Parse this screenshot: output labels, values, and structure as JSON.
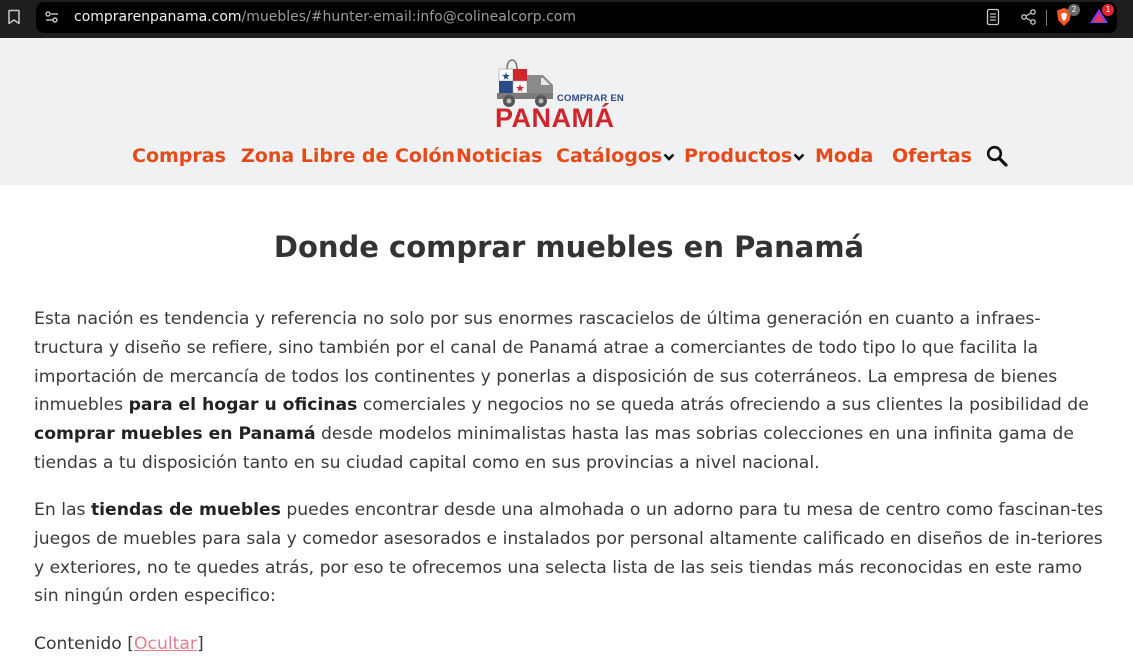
{
  "browser": {
    "url_host": "comprarenpanama.com",
    "url_path": "/muebles/#hunter-email:info@colinealcorp.com",
    "brave_shields_count": "2",
    "rewards_count": "1"
  },
  "site": {
    "logo_small": "COMPRAR EN",
    "logo_main": "PANAMÁ",
    "nav": [
      "Compras",
      "Zona Libre de Colón",
      "Noticias",
      "Catálogos",
      "Productos",
      "Moda",
      "Ofertas"
    ]
  },
  "article": {
    "title": "Donde comprar muebles en Panamá",
    "p1": {
      "t1": "Esta nación es tendencia y referencia no solo por sus enormes rascacielos de última generación en cuanto a infraes-tructura y diseño se refiere, sino también por el canal de Panamá atrae a comerciantes de todo tipo lo que facilita la importación de mercancía de todos los continentes y ponerlas a disposición de sus coterráneos. La empresa de bienes inmuebles ",
      "b1": "para el hogar u oficinas",
      "t2": " comerciales y negocios no se queda atrás ofreciendo a sus clientes la posibilidad de ",
      "b2": "comprar muebles en Panamá",
      "t3": " desde modelos minimalistas hasta las mas sobrias colecciones en una infinita gama de tiendas a tu disposición tanto en su ciudad capital como en sus provincias a nivel nacional."
    },
    "p2": {
      "t1": "En las ",
      "b1": "tiendas de muebles",
      "t2": " puedes encontrar desde una almohada o un adorno para tu mesa de centro como fascinan-tes juegos de muebles para sala y comedor asesorados e instalados por personal altamente calificado en diseños de in-teriores y exteriores, no te quedes atrás, por eso te ofrecemos una selecta lista de las seis tiendas más reconocidas en este ramo sin ningún orden especifico:"
    },
    "toc_label": "Contenido [",
    "toc_toggle": "Ocultar",
    "toc_close": "]"
  },
  "colors": {
    "nav_orange": "#e64a19",
    "logo_red": "#d0262b",
    "logo_blue": "#2c4a8a",
    "toc_link": "#e0808b"
  }
}
